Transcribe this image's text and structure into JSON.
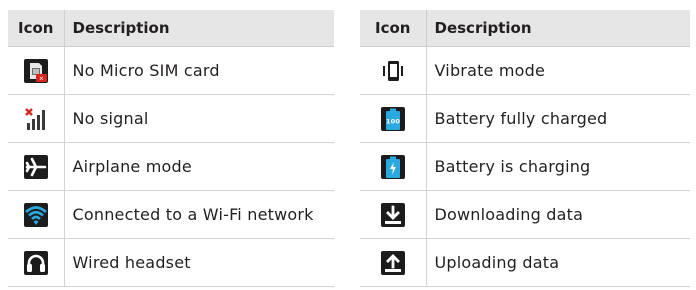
{
  "headers": {
    "icon": "Icon",
    "description": "Description"
  },
  "left_rows": [
    {
      "icon": "no-sim-card-icon",
      "description": "No Micro SIM card"
    },
    {
      "icon": "no-signal-icon",
      "description": "No signal"
    },
    {
      "icon": "airplane-icon",
      "description": "Airplane mode"
    },
    {
      "icon": "wifi-icon",
      "description": "Connected to a Wi-Fi network"
    },
    {
      "icon": "headset-icon",
      "description": "Wired headset"
    }
  ],
  "right_rows": [
    {
      "icon": "vibrate-icon",
      "description": "Vibrate mode"
    },
    {
      "icon": "battery-full-icon",
      "description": "Battery fully charged",
      "badge": "100"
    },
    {
      "icon": "battery-charging-icon",
      "description": "Battery is charging"
    },
    {
      "icon": "download-icon",
      "description": "Downloading data"
    },
    {
      "icon": "upload-icon",
      "description": "Uploading data"
    }
  ],
  "colors": {
    "header_bg": "#e6e6e6",
    "icon_bg": "#1c1c1c",
    "status_blue": "#2aa8e0",
    "alert_red": "#d9261c"
  }
}
